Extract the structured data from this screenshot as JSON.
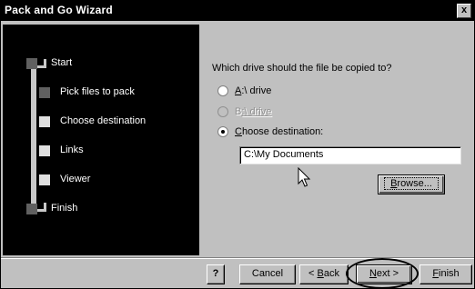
{
  "window": {
    "title": "Pack and Go Wizard",
    "close_label": "x"
  },
  "steps": [
    {
      "label": "Start",
      "state": "done"
    },
    {
      "label": "Pick files to pack",
      "state": "done"
    },
    {
      "label": "Choose destination",
      "state": "current"
    },
    {
      "label": "Links",
      "state": "pending"
    },
    {
      "label": "Viewer",
      "state": "pending"
    },
    {
      "label": "Finish",
      "state": "pending"
    }
  ],
  "content": {
    "question": "Which drive should the file be copied to?",
    "options": [
      {
        "prefix": "A",
        "rest": ":\\ drive",
        "selected": false,
        "disabled": false
      },
      {
        "prefix": "B",
        "rest": ":\\ drive",
        "selected": false,
        "disabled": true
      },
      {
        "prefix": "C",
        "rest": "hoose destination:",
        "selected": true,
        "disabled": false
      }
    ],
    "path_value": "C:\\My Documents",
    "browse_prefix": "B",
    "browse_rest": "rowse..."
  },
  "buttons": {
    "help": "?",
    "cancel": "Cancel",
    "back_prefix": "< ",
    "back_ul": "B",
    "back_rest": "ack",
    "next_ul": "N",
    "next_rest": "ext >",
    "finish_ul": "F",
    "finish_rest": "inish"
  },
  "colors": {
    "title_bar": "#000000",
    "left_panel": "#000000",
    "dialog_face": "#c0c0c0"
  }
}
